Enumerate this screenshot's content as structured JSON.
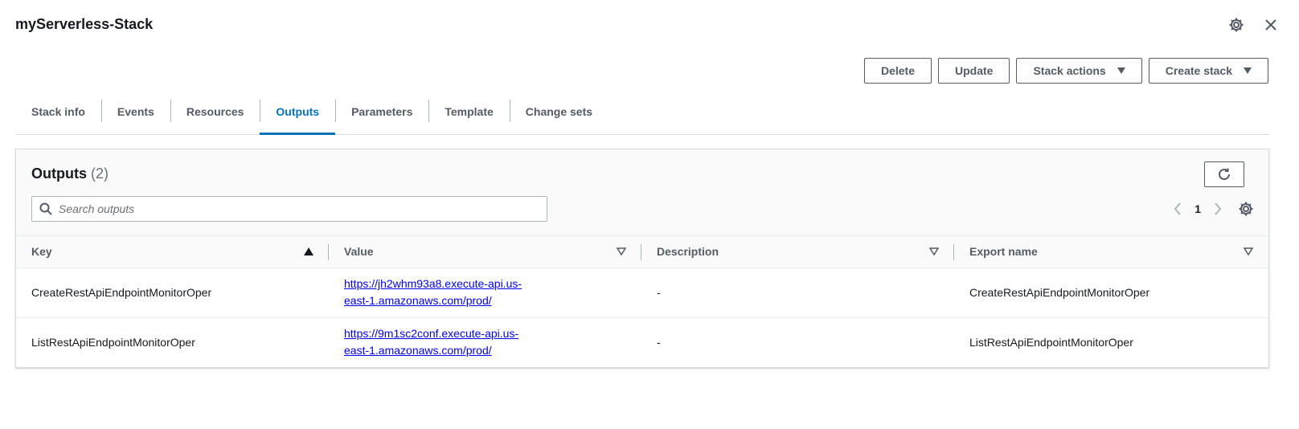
{
  "header": {
    "title": "myServerless-Stack",
    "settings_icon": "gear-icon",
    "close_icon": "close-icon"
  },
  "actions": {
    "delete": "Delete",
    "update": "Update",
    "stack_actions": "Stack actions",
    "create_stack": "Create stack"
  },
  "tabs": [
    {
      "label": "Stack info"
    },
    {
      "label": "Events"
    },
    {
      "label": "Resources"
    },
    {
      "label": "Outputs",
      "active": true
    },
    {
      "label": "Parameters"
    },
    {
      "label": "Template"
    },
    {
      "label": "Change sets"
    }
  ],
  "outputs": {
    "title": "Outputs",
    "count": "(2)",
    "search_placeholder": "Search outputs",
    "page": "1",
    "columns": [
      "Key",
      "Value",
      "Description",
      "Export name"
    ],
    "sort": {
      "column": "Key",
      "direction": "ascending"
    },
    "rows": [
      {
        "key": "CreateRestApiEndpointMonitorOper",
        "value": "https://jh2whm93a8.execute-api.us-east-1.amazonaws.com/prod/",
        "description": "-",
        "export_name": "CreateRestApiEndpointMonitorOper"
      },
      {
        "key": "ListRestApiEndpointMonitorOper",
        "value": "https://9m1sc2conf.execute-api.us-east-1.amazonaws.com/prod/",
        "description": "-",
        "export_name": "ListRestApiEndpointMonitorOper"
      }
    ]
  },
  "colors": {
    "accent": "#0073bb",
    "link": "#0000ee",
    "text": "#16191f",
    "muted": "#545b64"
  }
}
